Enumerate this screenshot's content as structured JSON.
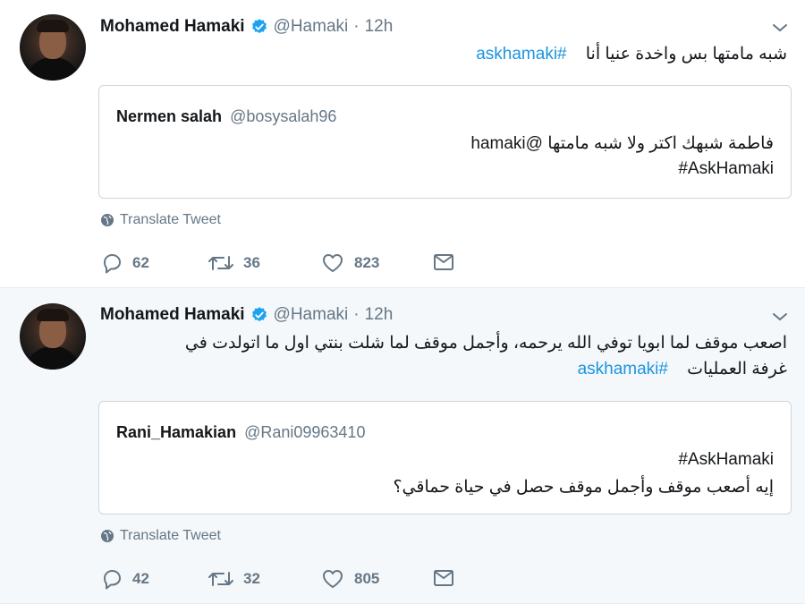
{
  "tweets": [
    {
      "author_name": "Mohamed Hamaki",
      "author_handle": "@Hamaki",
      "dot": "·",
      "time": "12h",
      "text_lines": [
        "شبه مامتها بس واخدة عنيا أنا"
      ],
      "hashtag": "#askhamaki",
      "quote": {
        "name": "Nermen salah",
        "handle": "@bosysalah96",
        "lines": [
          "فاطمة شبهك اكتر ولا شبه مامتها @hamaki",
          "#AskHamaki"
        ]
      },
      "translate_label": "Translate Tweet",
      "replies": "62",
      "retweets": "36",
      "likes": "823"
    },
    {
      "author_name": "Mohamed Hamaki",
      "author_handle": "@Hamaki",
      "dot": "·",
      "time": "12h",
      "text_lines": [
        "اصعب موقف لما ابويا توفي الله يرحمه، وأجمل موقف لما شلت بنتي اول ما اتولدت في",
        "غرفة العمليات"
      ],
      "hashtag": "#askhamaki",
      "quote": {
        "name": "Rani_Hamakian",
        "handle": "@Rani09963410",
        "lines": [
          "#AskHamaki",
          "إيه أصعب موقف وأجمل موقف حصل في حياة حماقي؟"
        ]
      },
      "translate_label": "Translate Tweet",
      "replies": "42",
      "retweets": "32",
      "likes": "805"
    }
  ],
  "colors": {
    "link": "#1b95e0",
    "verified": "#1da1f2",
    "muted": "#657786",
    "border": "#ccd6dd"
  },
  "icons": [
    "verified-badge-icon",
    "chevron-down-icon",
    "globe-icon",
    "reply-icon",
    "retweet-icon",
    "like-icon",
    "direct-message-icon"
  ]
}
